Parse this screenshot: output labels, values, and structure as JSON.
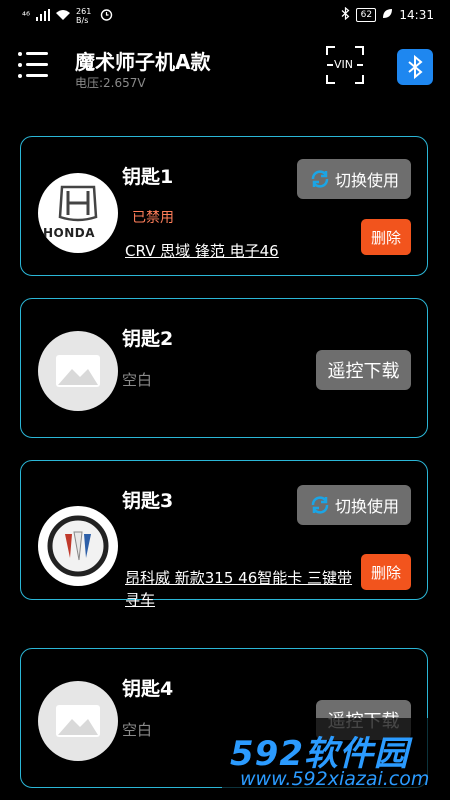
{
  "status_bar": {
    "network": "⁴⁶",
    "speed": "261 B/s",
    "battery": "62",
    "time": "14:31"
  },
  "header": {
    "title": "魔术师子机A款",
    "voltage": "电压:2.657V",
    "vin_label": "VIN"
  },
  "keys": [
    {
      "name": "钥匙1",
      "status": "已禁用",
      "desc": "CRV 思域 锋范 电子46",
      "switch_label": "切换使用",
      "delete_label": "删除",
      "brand": "HONDA"
    },
    {
      "name": "钥匙2",
      "blank": "空白",
      "download_label": "遥控下载"
    },
    {
      "name": "钥匙3",
      "desc": "昂科威 新款315 46智能卡 三键带寻车",
      "switch_label": "切换使用",
      "delete_label": "删除"
    },
    {
      "name": "钥匙4",
      "blank": "空白",
      "download_label": "遥控下载"
    }
  ],
  "watermark": {
    "main": "592软件园",
    "url": "www.592xiazai.com"
  },
  "colors": {
    "card_border": "#2bb6d6",
    "delete_button": "#f2541d",
    "disabled_text": "#ff7e5a",
    "bluetooth": "#1e87f0"
  }
}
